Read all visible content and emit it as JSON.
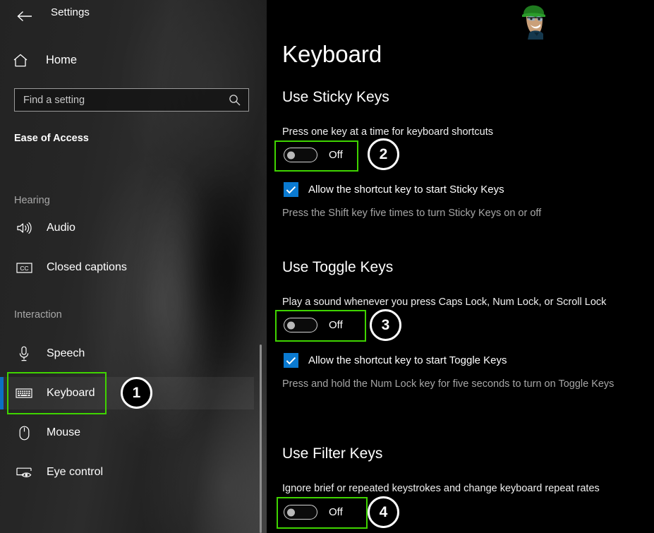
{
  "window": {
    "title": "Settings",
    "back_icon": "back-arrow-icon"
  },
  "sidebar": {
    "home": {
      "label": "Home",
      "icon": "home-icon"
    },
    "search": {
      "placeholder": "Find a setting",
      "icon": "search-icon"
    },
    "app_section": "Ease of Access",
    "groups": [
      {
        "label": "Hearing",
        "items": [
          {
            "label": "Audio",
            "icon": "speaker-icon",
            "selected": false
          },
          {
            "label": "Closed captions",
            "icon": "closed-captions-icon",
            "selected": false
          }
        ]
      },
      {
        "label": "Interaction",
        "items": [
          {
            "label": "Speech",
            "icon": "microphone-icon",
            "selected": false
          },
          {
            "label": "Keyboard",
            "icon": "keyboard-icon",
            "selected": true
          },
          {
            "label": "Mouse",
            "icon": "mouse-icon",
            "selected": false
          },
          {
            "label": "Eye control",
            "icon": "eye-control-icon",
            "selected": false
          }
        ]
      }
    ]
  },
  "main": {
    "page_title": "Keyboard",
    "avatar_icon": "cartoon-avatar-watermark",
    "sections": [
      {
        "heading": "Use Sticky Keys",
        "description": "Press one key at a time for keyboard shortcuts",
        "toggle_state": "Off",
        "checkbox_label": "Allow the shortcut key to start Sticky Keys",
        "checkbox_checked": true,
        "hint": "Press the Shift key five times to turn Sticky Keys on or off"
      },
      {
        "heading": "Use Toggle Keys",
        "description": "Play a sound whenever you press Caps Lock, Num Lock, or Scroll Lock",
        "toggle_state": "Off",
        "checkbox_label": "Allow the shortcut key to start Toggle Keys",
        "checkbox_checked": true,
        "hint": "Press and hold the Num Lock key for five seconds to turn on Toggle Keys"
      },
      {
        "heading": "Use Filter Keys",
        "description": "Ignore brief or repeated keystrokes and change keyboard repeat rates",
        "toggle_state": "Off"
      }
    ]
  },
  "annotations": {
    "highlight_color": "#3fd400",
    "badges": [
      {
        "number": "1",
        "style": "filled"
      },
      {
        "number": "2",
        "style": "hollow"
      },
      {
        "number": "3",
        "style": "hollow"
      },
      {
        "number": "4",
        "style": "hollow"
      }
    ]
  },
  "colors": {
    "accent_blue": "#0a7ad1",
    "selection_bar": "#0c6fc4",
    "annotation_green": "#3fd400"
  }
}
